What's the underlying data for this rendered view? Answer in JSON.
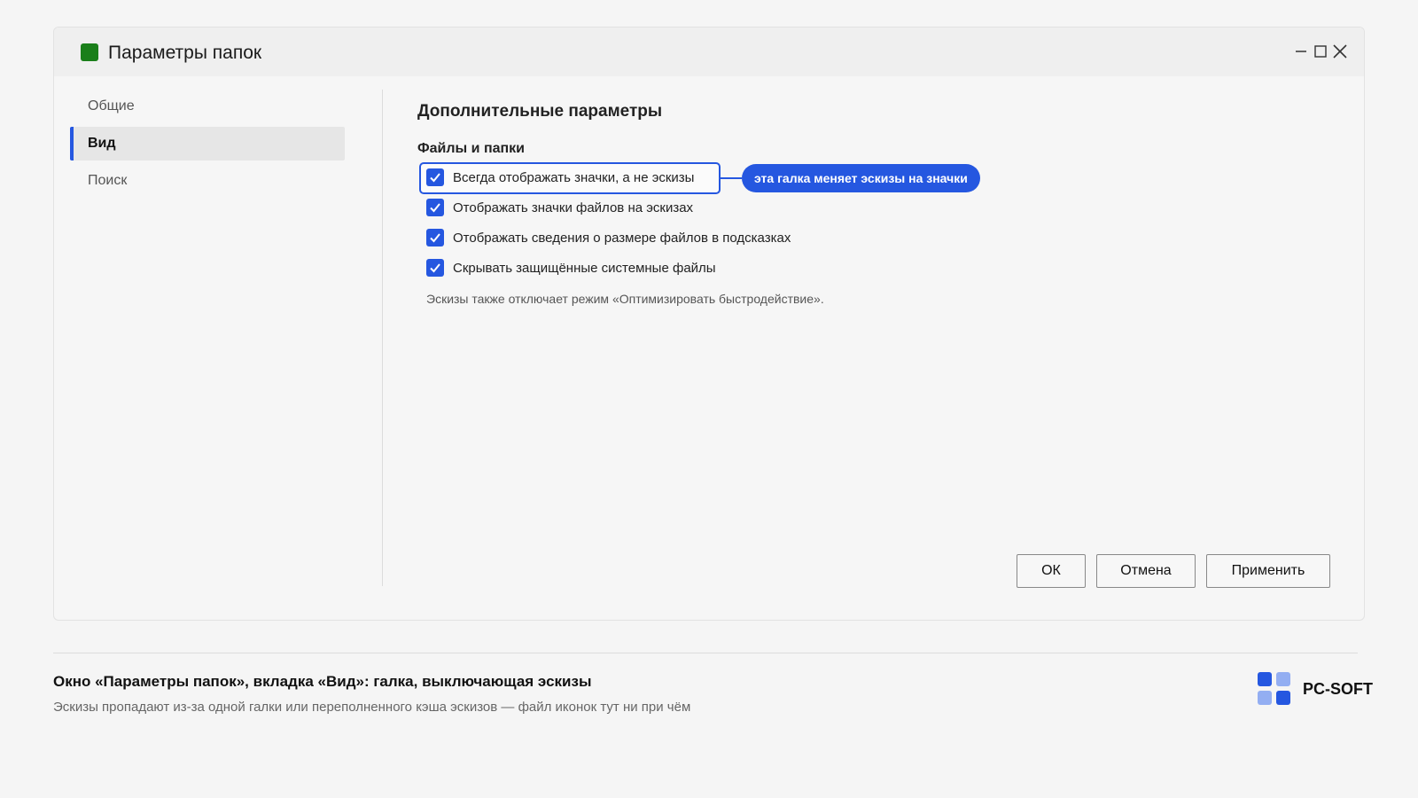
{
  "window": {
    "title": "Параметры папок",
    "app_icon_color": "#1a7f1a",
    "controls": [
      "minimize-icon",
      "maximize-icon",
      "close-icon"
    ]
  },
  "sidebar": {
    "items": [
      {
        "label": "Общие",
        "active": false
      },
      {
        "label": "Вид",
        "active": true
      },
      {
        "label": "Поиск",
        "active": false
      }
    ]
  },
  "main": {
    "section_title": "Дополнительные параметры",
    "group_title": "Файлы и папки",
    "options": [
      {
        "label": "Всегда отображать значки, а не эскизы",
        "checked": true,
        "highlighted": true
      },
      {
        "label": "Отображать значки файлов на эскизах",
        "checked": true
      },
      {
        "label": "Отображать сведения о размере файлов в подсказках",
        "checked": true
      },
      {
        "label": "Скрывать защищённые системные файлы",
        "checked": true
      }
    ],
    "callout": "эта галка меняет эскизы на значки",
    "note": "Эскизы также отключает режим «Оптимизировать быстродействие»."
  },
  "buttons": {
    "ok": "ОК",
    "cancel": "Отмена",
    "apply": "Применить"
  },
  "caption": {
    "title": "Окно «Параметры папок», вкладка «Вид»: галка, выключающая эскизы",
    "subtitle": "Эскизы пропадают из-за одной галки или переполненного кэша эскизов — файл иконок тут ни при чём"
  },
  "brand": {
    "name": "PC-SOFT",
    "accent": "#2557e0",
    "accent_light": "#93aef2"
  }
}
